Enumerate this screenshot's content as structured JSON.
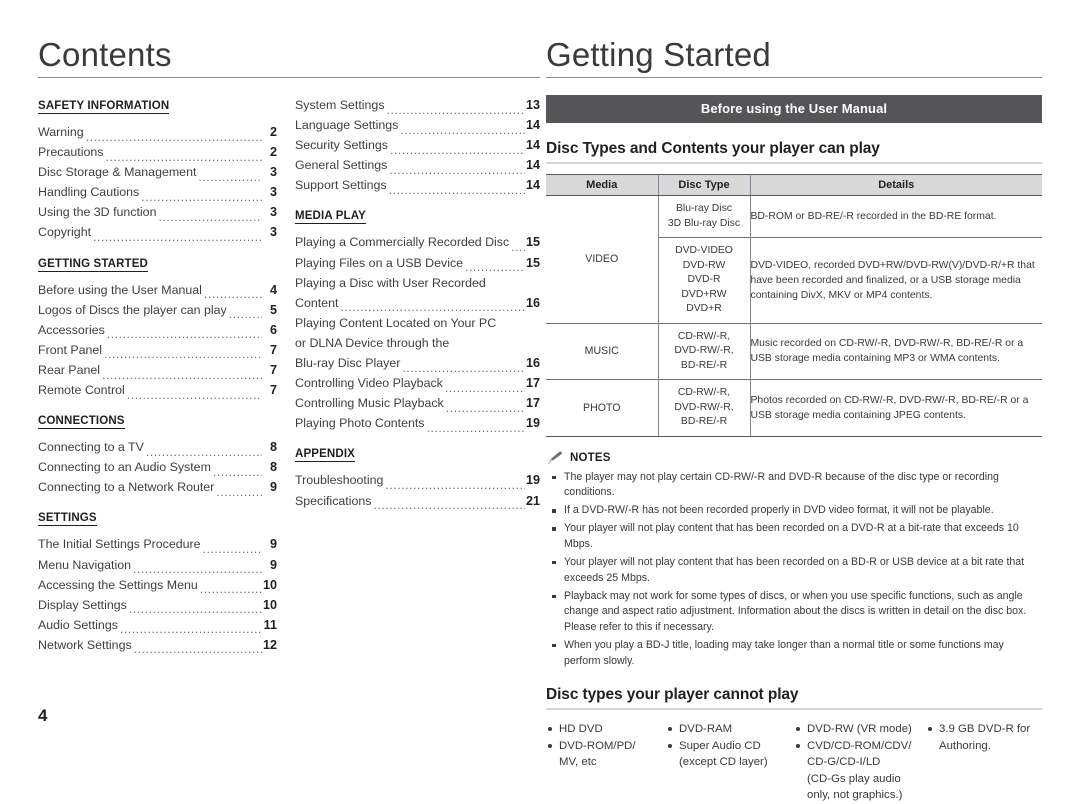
{
  "left": {
    "title": "Contents",
    "column1": [
      {
        "type": "head",
        "label": "SAFETY INFORMATION"
      },
      {
        "type": "entry",
        "label": "Warning",
        "page": "2"
      },
      {
        "type": "entry",
        "label": "Precautions",
        "page": "2"
      },
      {
        "type": "entry",
        "label": "Disc Storage & Management",
        "page": "3"
      },
      {
        "type": "entry",
        "label": "Handling Cautions",
        "page": "3"
      },
      {
        "type": "entry",
        "label": "Using the 3D function",
        "page": "3"
      },
      {
        "type": "entry",
        "label": "Copyright",
        "page": "3"
      },
      {
        "type": "head",
        "label": "GETTING STARTED"
      },
      {
        "type": "entry",
        "label": "Before using the User Manual",
        "page": "4"
      },
      {
        "type": "entry",
        "label": "Logos of Discs the player can play",
        "page": "5"
      },
      {
        "type": "entry",
        "label": "Accessories",
        "page": "6"
      },
      {
        "type": "entry",
        "label": "Front Panel",
        "page": "7"
      },
      {
        "type": "entry",
        "label": "Rear Panel",
        "page": "7"
      },
      {
        "type": "entry",
        "label": "Remote Control",
        "page": "7"
      },
      {
        "type": "head",
        "label": "CONNECTIONS"
      },
      {
        "type": "entry",
        "label": "Connecting to a TV",
        "page": "8"
      },
      {
        "type": "entry",
        "label": "Connecting to an Audio System",
        "page": "8"
      },
      {
        "type": "entry",
        "label": "Connecting to a Network Router",
        "page": "9"
      },
      {
        "type": "head",
        "label": "SETTINGS"
      },
      {
        "type": "entry",
        "label": "The Initial Settings Procedure",
        "page": "9"
      },
      {
        "type": "entry",
        "label": "Menu Navigation",
        "page": "9"
      },
      {
        "type": "entry",
        "label": "Accessing the Settings Menu",
        "page": "10"
      },
      {
        "type": "entry",
        "label": "Display Settings",
        "page": "10"
      },
      {
        "type": "entry",
        "label": "Audio Settings",
        "page": "11"
      },
      {
        "type": "entry",
        "label": "Network Settings",
        "page": "12"
      }
    ],
    "column2": [
      {
        "type": "entry",
        "label": "System Settings",
        "page": "13"
      },
      {
        "type": "entry",
        "label": "Language Settings",
        "page": "14"
      },
      {
        "type": "entry",
        "label": "Security Settings",
        "page": "14"
      },
      {
        "type": "entry",
        "label": "General Settings",
        "page": "14"
      },
      {
        "type": "entry",
        "label": "Support Settings",
        "page": "14"
      },
      {
        "type": "head",
        "label": "MEDIA PLAY"
      },
      {
        "type": "entry",
        "label": "Playing a Commercially Recorded Disc",
        "page": "15"
      },
      {
        "type": "entry",
        "label": "Playing Files on a USB Device",
        "page": "15"
      },
      {
        "type": "wrap",
        "label": "Playing a Disc with User Recorded"
      },
      {
        "type": "entry",
        "label": "Content",
        "page": "16"
      },
      {
        "type": "wrap",
        "label": "Playing Content Located on Your PC"
      },
      {
        "type": "wrap",
        "label": "or DLNA Device through the"
      },
      {
        "type": "entry",
        "label": "Blu-ray Disc Player",
        "page": "16"
      },
      {
        "type": "entry",
        "label": "Controlling Video Playback",
        "page": "17"
      },
      {
        "type": "entry",
        "label": "Controlling Music Playback",
        "page": "17"
      },
      {
        "type": "entry",
        "label": "Playing Photo Contents",
        "page": "19"
      },
      {
        "type": "head",
        "label": "APPENDIX"
      },
      {
        "type": "entry",
        "label": "Troubleshooting",
        "page": "19"
      },
      {
        "type": "entry",
        "label": "Specifications",
        "page": "21"
      }
    ]
  },
  "right": {
    "title": "Getting Started",
    "section_bar": "Before using the User Manual",
    "sub_head": "Disc Types and Contents your player can play",
    "table": {
      "headers": [
        "Media",
        "Disc Type",
        "Details"
      ],
      "rows": [
        {
          "media": "VIDEO",
          "media_rowspan": 2,
          "type": "Blu-ray Disc\n3D Blu-ray Disc",
          "details": "BD-ROM or BD-RE/-R recorded in the BD-RE format."
        },
        {
          "media": "",
          "type": "DVD-VIDEO\nDVD-RW\nDVD-R\nDVD+RW\nDVD+R",
          "details": "DVD-VIDEO, recorded DVD+RW/DVD-RW(V)/DVD-R/+R that have been recorded and finalized, or a USB storage media containing DivX, MKV or MP4 contents."
        },
        {
          "media": "MUSIC",
          "type": "CD-RW/-R,\nDVD-RW/-R,\nBD-RE/-R",
          "details": "Music recorded on CD-RW/-R, DVD-RW/-R, BD-RE/-R or a USB storage media containing MP3 or WMA contents."
        },
        {
          "media": "PHOTO",
          "type": "CD-RW/-R,\nDVD-RW/-R,\nBD-RE/-R",
          "details": "Photos recorded on CD-RW/-R, DVD-RW/-R, BD-RE/-R or a USB storage media containing JPEG contents."
        }
      ]
    },
    "notes": {
      "icon": "pencil-icon",
      "title": "NOTES",
      "items": [
        "The player may not play certain CD-RW/-R and DVD-R because of the disc type or recording conditions.",
        "If a DVD-RW/-R has not been recorded properly in DVD video format, it will not be playable.",
        "Your player will not play content that has been recorded on a DVD-R at a bit-rate that exceeds 10 Mbps.",
        "Your player will not play content that has been recorded on a BD-R or USB device at a bit rate that exceeds 25 Mbps.",
        "Playback may not work for some types of discs, or when you use specific functions, such as angle change and aspect ratio adjustment. Information about the discs is written in detail on the disc box. Please refer to this if necessary.",
        "When you play a BD-J title, loading may take longer than a normal title or some functions may perform slowly."
      ]
    },
    "cannot_play": {
      "heading": "Disc types your player cannot play",
      "columns": [
        [
          {
            "bullet": true,
            "text": "HD DVD"
          },
          {
            "bullet": true,
            "text": "DVD-ROM/PD/"
          },
          {
            "bullet": false,
            "text": "MV, etc"
          }
        ],
        [
          {
            "bullet": true,
            "text": "DVD-RAM"
          },
          {
            "bullet": true,
            "text": "Super Audio CD"
          },
          {
            "bullet": false,
            "text": "(except CD layer)"
          }
        ],
        [
          {
            "bullet": true,
            "text": "DVD-RW (VR mode)"
          },
          {
            "bullet": true,
            "text": "CVD/CD-ROM/CDV/"
          },
          {
            "bullet": false,
            "text": "CD-G/CD-I/LD"
          },
          {
            "bullet": false,
            "text": "(CD-Gs play audio"
          },
          {
            "bullet": false,
            "text": "only, not graphics.)"
          }
        ],
        [
          {
            "bullet": true,
            "text": "3.9 GB DVD-R for"
          },
          {
            "bullet": false,
            "text": "Authoring."
          }
        ]
      ]
    }
  },
  "folio": "4",
  "colors": {
    "section_bar_bg": "#555557",
    "table_header_bg": "#d8d8d8",
    "rule": "#d7d7d7",
    "text": "#231f20",
    "body_text": "#3a3a3a",
    "table_divider": "#8b7f93"
  }
}
